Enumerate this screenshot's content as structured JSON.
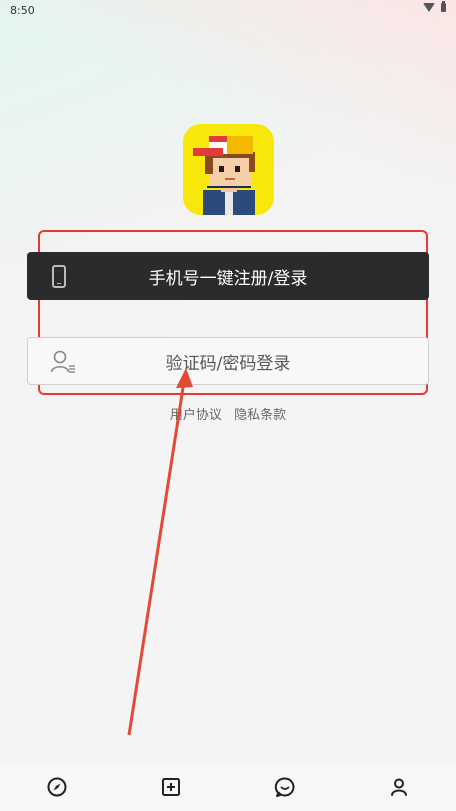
{
  "status_bar": {
    "time": "8:50",
    "icons": [
      "wifi-icon",
      "battery-icon"
    ]
  },
  "login": {
    "phone_button_label": "手机号一键注册/登录",
    "code_button_label": "验证码/密码登录"
  },
  "agreement": {
    "user_agreement": "用户协议",
    "privacy_policy": "隐私条款"
  },
  "bottom_nav": {
    "items": [
      "compass-icon",
      "add-square-icon",
      "chat-icon",
      "profile-icon"
    ]
  },
  "colors": {
    "primary_button_bg": "#2b2b2b",
    "highlight_box": "#e53935",
    "annotation_arrow": "#e34a35",
    "logo_bg": "#f7e70a"
  }
}
